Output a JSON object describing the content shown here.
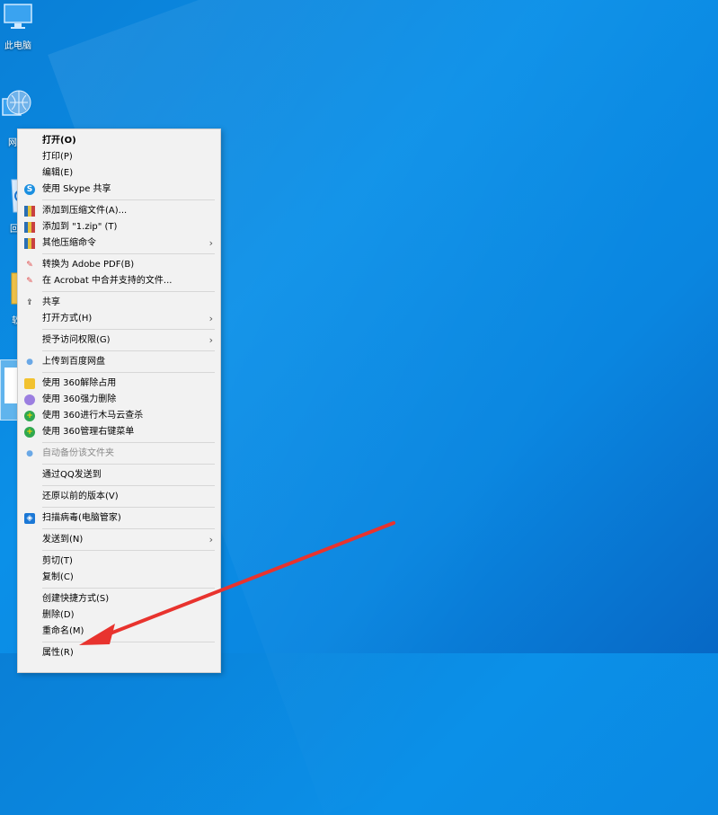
{
  "desktop": {
    "icons": [
      {
        "label": "此电脑"
      },
      {
        "label": "网"
      },
      {
        "label": "回"
      },
      {
        "label": "软"
      }
    ]
  },
  "context_menu": {
    "items": [
      {
        "label": "打开(O)",
        "bold": true
      },
      {
        "label": "打印(P)"
      },
      {
        "label": "编辑(E)"
      },
      {
        "label": "使用 Skype 共享",
        "icon": "skype-icon"
      },
      {
        "separator": true
      },
      {
        "label": "添加到压缩文件(A)...",
        "icon": "archive-icon"
      },
      {
        "label": "添加到 \"1.zip\" (T)",
        "icon": "archive-icon"
      },
      {
        "label": "其他压缩命令",
        "icon": "archive-icon",
        "submenu": true
      },
      {
        "separator": true
      },
      {
        "label": "转换为 Adobe PDF(B)",
        "icon": "pdf-icon"
      },
      {
        "label": "在 Acrobat 中合并支持的文件...",
        "icon": "pdf-icon"
      },
      {
        "separator": true
      },
      {
        "label": "共享",
        "icon": "share-icon"
      },
      {
        "label": "打开方式(H)",
        "submenu": true
      },
      {
        "separator": true
      },
      {
        "label": "授予访问权限(G)",
        "submenu": true
      },
      {
        "separator": true
      },
      {
        "label": "上传到百度网盘",
        "icon": "cloud-icon"
      },
      {
        "separator": true
      },
      {
        "label": "使用 360解除占用",
        "icon": "unlock-360-icon"
      },
      {
        "label": "使用 360强力删除",
        "icon": "delete-360-icon"
      },
      {
        "label": "使用 360进行木马云查杀",
        "icon": "scan-360-icon"
      },
      {
        "label": "使用 360管理右键菜单",
        "icon": "manage-360-icon"
      },
      {
        "separator": true
      },
      {
        "label": "自动备份该文件夹",
        "icon": "backup-icon",
        "disabled": true
      },
      {
        "separator": true
      },
      {
        "label": "通过QQ发送到"
      },
      {
        "separator": true
      },
      {
        "label": "还原以前的版本(V)"
      },
      {
        "separator": true
      },
      {
        "label": "扫描病毒(电脑管家)",
        "icon": "shield-icon"
      },
      {
        "separator": true
      },
      {
        "label": "发送到(N)",
        "submenu": true
      },
      {
        "separator": true
      },
      {
        "label": "剪切(T)"
      },
      {
        "label": "复制(C)"
      },
      {
        "separator": true
      },
      {
        "label": "创建快捷方式(S)"
      },
      {
        "label": "删除(D)"
      },
      {
        "label": "重命名(M)"
      },
      {
        "separator": true
      },
      {
        "label": "属性(R)"
      }
    ]
  },
  "colors": {
    "desktop": "#0b8ae3",
    "menu_bg": "#f2f2f2",
    "annotation_arrow": "#e8332e"
  }
}
